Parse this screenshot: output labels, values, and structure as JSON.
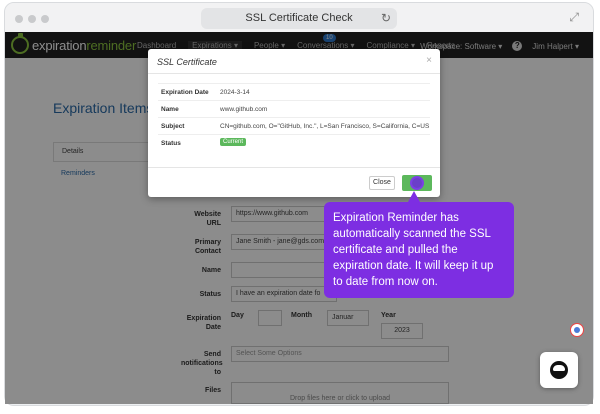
{
  "browser": {
    "title": "SSL Certificate Check",
    "reload_icon": "reload-icon",
    "expand_icon": "expand-icon"
  },
  "navbar": {
    "logo_part1": "expiration",
    "logo_part2": "reminder",
    "items": [
      "Dashboard",
      "Expirations ▾",
      "People ▾",
      "Conversations ▾",
      "Compliance ▾",
      "Reports"
    ],
    "conversations_badge": "10",
    "workspace": "Workspace: Software ▾",
    "user": "Jim Halpert ▾"
  },
  "page": {
    "title": "Expiration Items >",
    "details_tab": "Details",
    "reminders_link": "Reminders"
  },
  "form": {
    "website_label": "Website URL",
    "website_value": "https://www.github.com",
    "contact_label": "Primary Contact",
    "contact_value": "Jane Smith - jane@gds.com",
    "name_label": "Name",
    "name_value": "",
    "status_label": "Status",
    "status_value": "I have an expiration date fo",
    "expdate_label": "Expiration Date",
    "day_label": "Day",
    "month_label": "Month",
    "month_value": "Januar",
    "year_label": "Year",
    "year_value": "2023",
    "notifications_label": "Send notifications to",
    "notifications_placeholder": "Select Some Options",
    "files_label": "Files",
    "files_placeholder": "Drop files here or click to upload"
  },
  "modal": {
    "title": "SSL Certificate",
    "close_icon": "×",
    "rows": [
      {
        "key": "Expiration Date",
        "value": "2024-3-14"
      },
      {
        "key": "Name",
        "value": "www.github.com"
      },
      {
        "key": "Subject",
        "value": "CN=github.com, O=\"GitHub, Inc.\", L=San Francisco, S=California, C=US"
      },
      {
        "key": "Status",
        "value": "Current"
      }
    ],
    "close_button": "Close",
    "ok_button": "ok"
  },
  "tooltip": {
    "text": "Expiration Reminder has automatically scanned the SSL certificate and pulled the expiration date. It will keep it up to date from now on."
  },
  "colors": {
    "accent_green": "#8cc63f",
    "tooltip_purple": "#7d2ee2",
    "status_green": "#5cb85c",
    "link_blue": "#2a6aa8"
  }
}
